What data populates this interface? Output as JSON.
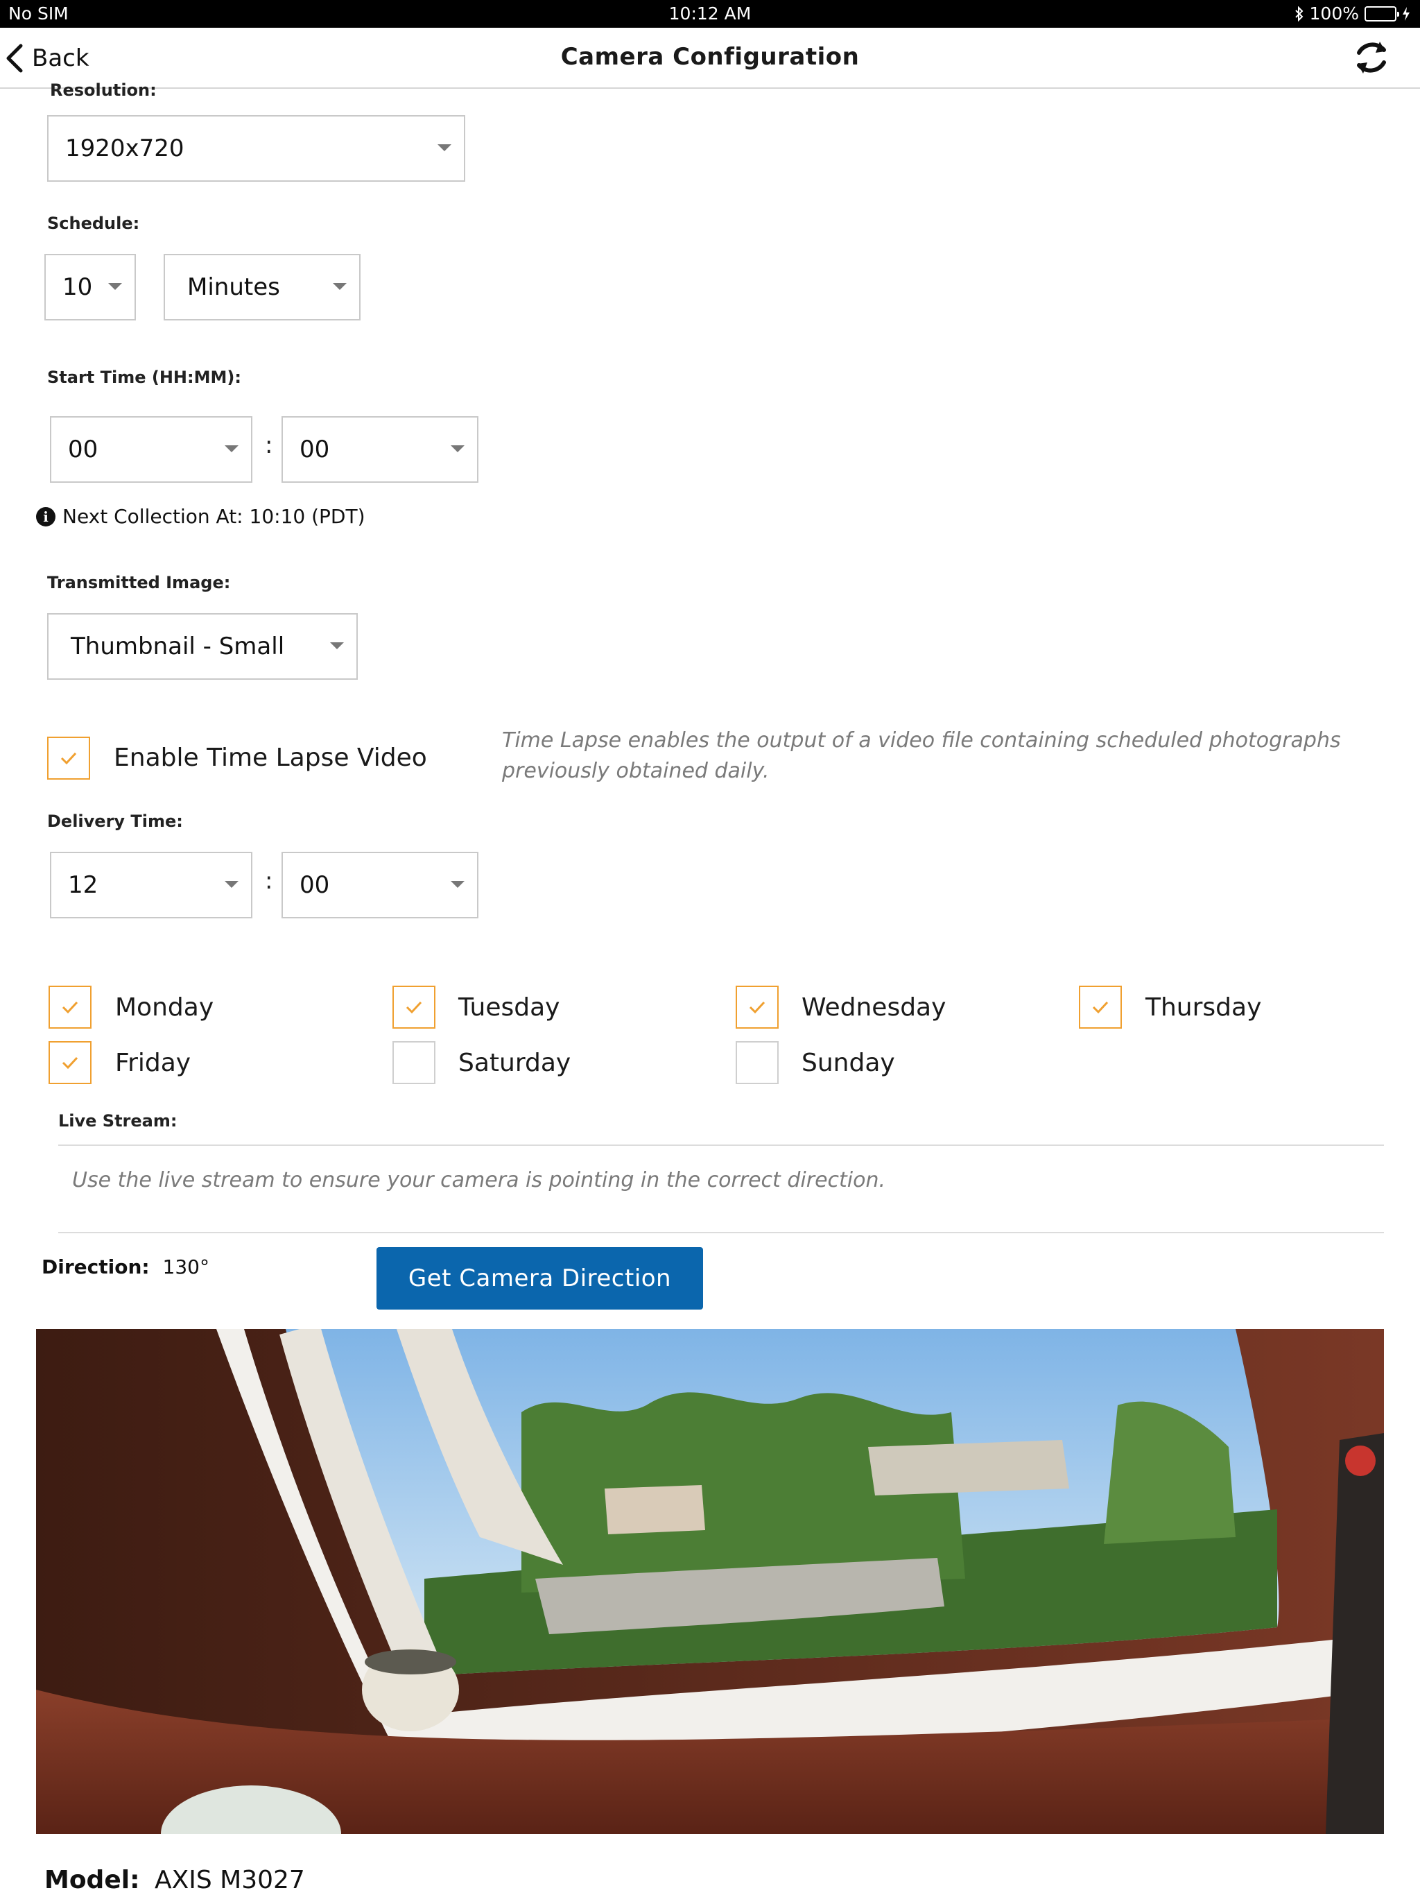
{
  "status_bar": {
    "carrier": "No SIM",
    "time": "10:12 AM",
    "battery": "100%"
  },
  "nav": {
    "back_label": "Back",
    "title": "Camera Configuration"
  },
  "resolution": {
    "label": "Resolution:",
    "value": "1920x720"
  },
  "schedule": {
    "label": "Schedule:",
    "interval_value": "10",
    "unit_value": "Minutes"
  },
  "start_time": {
    "label": "Start Time (HH:MM):",
    "hours": "00",
    "minutes": "00",
    "separator": ":"
  },
  "next_collection": "Next Collection At: 10:10 (PDT)",
  "transmitted_image": {
    "label": "Transmitted Image:",
    "value": "Thumbnail - Small"
  },
  "time_lapse": {
    "label": "Enable Time Lapse Video",
    "checked": true,
    "hint": "Time Lapse enables the output of a video file containing scheduled photographs previously obtained daily."
  },
  "delivery_time": {
    "label": "Delivery Time:",
    "hours": "12",
    "minutes": "00",
    "separator": ":"
  },
  "days": [
    {
      "label": "Monday",
      "checked": true
    },
    {
      "label": "Tuesday",
      "checked": true
    },
    {
      "label": "Wednesday",
      "checked": true
    },
    {
      "label": "Thursday",
      "checked": true
    },
    {
      "label": "Friday",
      "checked": true
    },
    {
      "label": "Saturday",
      "checked": false
    },
    {
      "label": "Sunday",
      "checked": false
    }
  ],
  "live_stream": {
    "label": "Live Stream:",
    "hint": "Use the live stream to ensure your camera is pointing in the correct direction."
  },
  "direction": {
    "label": "Direction:",
    "value": "130°"
  },
  "get_direction_button": "Get Camera Direction",
  "model": {
    "label": "Model:",
    "value": "AXIS M3027"
  },
  "colors": {
    "accent_orange": "#f0a030",
    "primary_blue": "#0b66ad",
    "battery_green": "#4cd964"
  }
}
